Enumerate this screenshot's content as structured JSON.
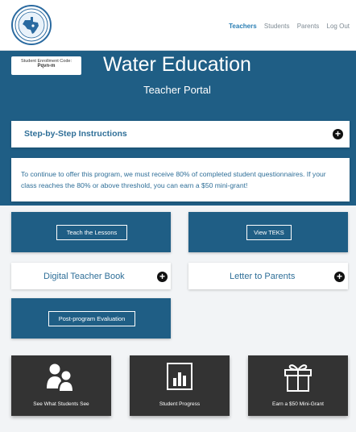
{
  "logo_text": "DRINK FOR THE TEXAS",
  "nav": {
    "items": [
      "Teachers",
      "Students",
      "Parents",
      "Log Out"
    ],
    "active": "Teachers"
  },
  "enrollment": {
    "label": "Student Enrollment Code:",
    "code": "Pqvn-m"
  },
  "page": {
    "title": "Water Education",
    "subtitle": "Teacher Portal"
  },
  "instructions": {
    "label": "Step-by-Step Instructions"
  },
  "notice": {
    "text": "To continue to offer this program, we must receive 80% of completed student questionnaires. If your class reaches the 80% or above threshold, you can earn a $50 mini-grant!"
  },
  "cards": {
    "teach": "Teach the Lessons",
    "teks": "View TEKS",
    "digital_book": "Digital Teacher Book",
    "letter": "Letter to Parents",
    "evaluation": "Post-program Evaluation"
  },
  "tiles": {
    "students": "See What Students See",
    "progress": "Student Progress",
    "grant": "Earn a $50 Mini-Grant"
  },
  "colors": {
    "brand_blue": "#1f5e85",
    "dark_tile": "#333333",
    "accent_text": "#2f6f98"
  }
}
